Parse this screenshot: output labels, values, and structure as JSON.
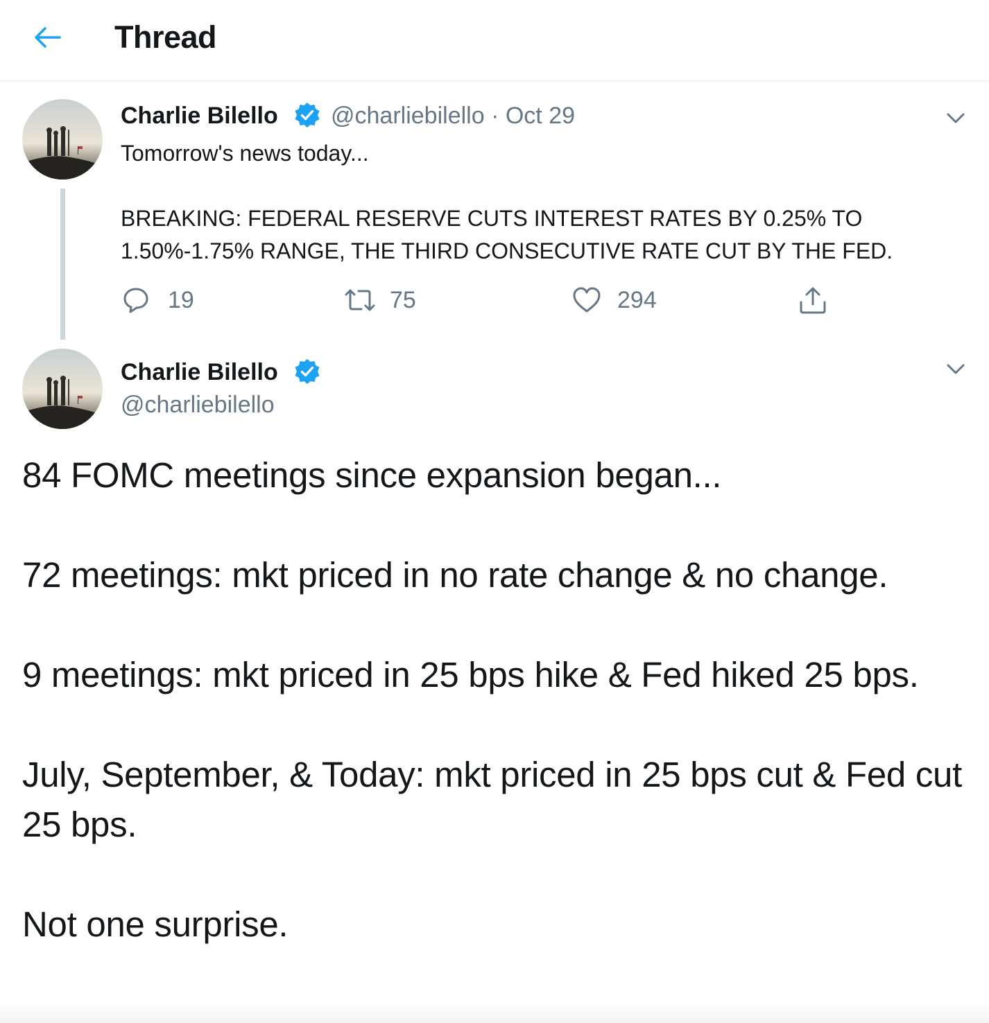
{
  "header": {
    "title": "Thread"
  },
  "tweet1": {
    "name": "Charlie Bilello",
    "handle": "@charliebilello",
    "separator": "·",
    "date": "Oct 29",
    "lines": [
      "Tomorrow's news today...",
      "",
      "BREAKING: FEDERAL RESERVE CUTS INTEREST RATES BY 0.25% TO",
      "1.50%-1.75% RANGE, THE THIRD CONSECUTIVE RATE CUT BY THE FED."
    ],
    "actions": {
      "replies": "19",
      "retweets": "75",
      "likes": "294"
    }
  },
  "tweet2": {
    "name": "Charlie Bilello",
    "handle": "@charliebilello",
    "paragraphs": [
      "84 FOMC meetings since expansion began...",
      "72 meetings: mkt priced in no rate change & no change.",
      "9 meetings: mkt priced in 25 bps hike & Fed hiked 25 bps.",
      "July, September, & Today: mkt priced in 25 bps cut & Fed cut 25 bps.",
      "Not one surprise."
    ]
  },
  "colors": {
    "accent": "#1da1f2",
    "text": "#14171a",
    "secondary": "#657786",
    "thread_line": "#ccd6dd",
    "divider": "#e6ecf0"
  },
  "icons": {
    "back": "arrow-left-icon",
    "verified": "verified-badge-icon",
    "more": "chevron-down-icon",
    "reply": "reply-icon",
    "retweet": "retweet-icon",
    "like": "heart-icon",
    "share": "share-icon"
  }
}
